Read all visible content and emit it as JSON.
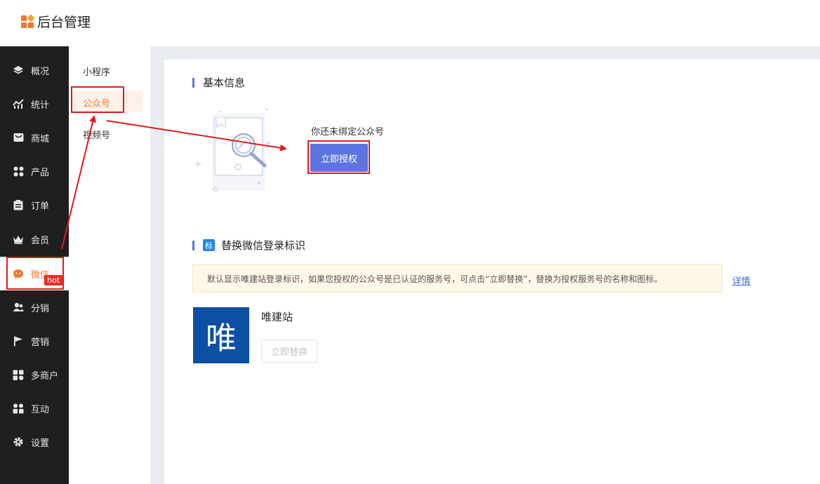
{
  "app": {
    "title": "后台管理",
    "logo_colors": [
      "#f0782d",
      "#f3a23a",
      "#5b74e0"
    ]
  },
  "sidebar": {
    "items": [
      {
        "label": "概况",
        "icon": "layers-icon"
      },
      {
        "label": "统计",
        "icon": "chart-icon"
      },
      {
        "label": "商城",
        "icon": "store-icon"
      },
      {
        "label": "产品",
        "icon": "grid-icon"
      },
      {
        "label": "订单",
        "icon": "clipboard-icon"
      },
      {
        "label": "会员",
        "icon": "crown-icon"
      },
      {
        "label": "微信",
        "icon": "wechat-icon",
        "active": true
      },
      {
        "label": "分销",
        "icon": "users-icon"
      },
      {
        "label": "营销",
        "icon": "flag-icon",
        "badge": "hot"
      },
      {
        "label": "多商户",
        "icon": "merchant-icon"
      },
      {
        "label": "互动",
        "icon": "interact-icon"
      },
      {
        "label": "设置",
        "icon": "gear-icon"
      }
    ],
    "active_color": "#f0782d",
    "badge_color": "#e2322d"
  },
  "subnav": {
    "items": [
      "小程序",
      "公众号",
      "视频号"
    ],
    "active": "公众号"
  },
  "basic_info": {
    "title": "基本信息",
    "unbound_text": "你还未绑定公众号",
    "authorize_button": "立即授权"
  },
  "replace_logo": {
    "tag": "标",
    "title": "替换微信登录标识",
    "notice": "默认显示唯建站登录标识，如果您授权的公众号是已认证的服务号，可点击“立即替换”，替换为授权服务号的名称和图标。",
    "detail_link": "详情",
    "avatar_char": "唯",
    "site_name": "唯建站",
    "replace_button": "立即替换"
  },
  "colors": {
    "primary": "#5b74e0",
    "annotation_red": "#e21a1a"
  }
}
